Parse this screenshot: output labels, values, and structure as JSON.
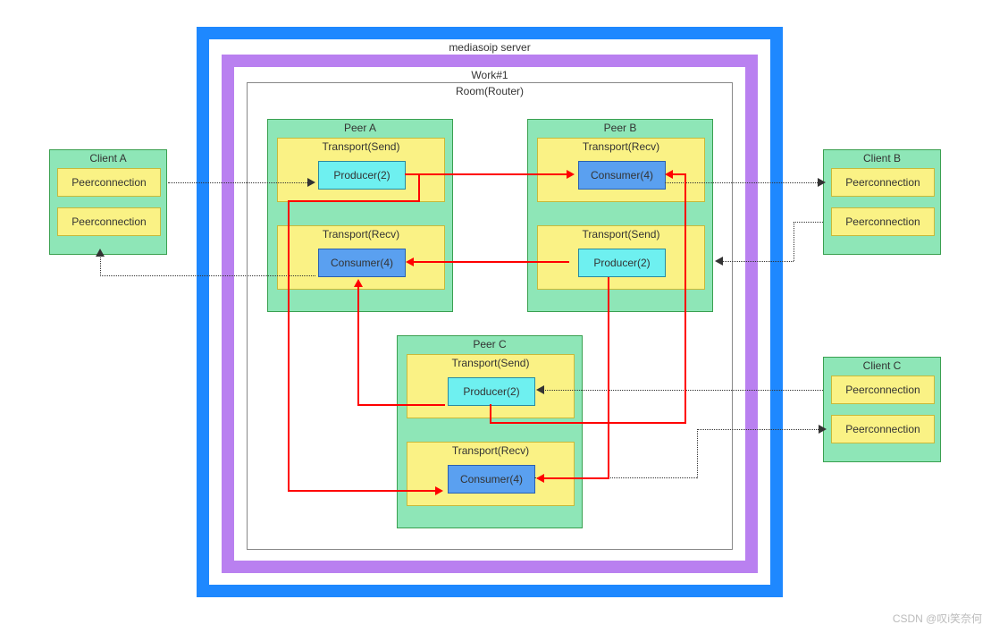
{
  "server": {
    "label": "mediasoip server"
  },
  "work": {
    "label": "Work#1"
  },
  "room": {
    "label": "Room(Router)"
  },
  "clients": {
    "a": {
      "label": "Client A",
      "pc1": "Peerconnection",
      "pc2": "Peerconnection"
    },
    "b": {
      "label": "Client B",
      "pc1": "Peerconnection",
      "pc2": "Peerconnection"
    },
    "c": {
      "label": "Client C",
      "pc1": "Peerconnection",
      "pc2": "Peerconnection"
    }
  },
  "peers": {
    "a": {
      "label": "Peer A",
      "send": {
        "label": "Transport(Send)",
        "node": "Producer(2)"
      },
      "recv": {
        "label": "Transport(Recv)",
        "node": "Consumer(4)"
      }
    },
    "b": {
      "label": "Peer B",
      "recv": {
        "label": "Transport(Recv)",
        "node": "Consumer(4)"
      },
      "send": {
        "label": "Transport(Send)",
        "node": "Producer(2)"
      }
    },
    "c": {
      "label": "Peer C",
      "send": {
        "label": "Transport(Send)",
        "node": "Producer(2)"
      },
      "recv": {
        "label": "Transport(Recv)",
        "node": "Consumer(4)"
      }
    }
  },
  "watermark": "CSDN @叹i笑奈何",
  "chart_data": {
    "type": "diagram",
    "title": "mediasoip server",
    "nodes": [
      {
        "id": "clientA",
        "label": "Client A",
        "children": [
          "clientA.pc1",
          "clientA.pc2"
        ]
      },
      {
        "id": "clientA.pc1",
        "label": "Peerconnection"
      },
      {
        "id": "clientA.pc2",
        "label": "Peerconnection"
      },
      {
        "id": "clientB",
        "label": "Client B",
        "children": [
          "clientB.pc1",
          "clientB.pc2"
        ]
      },
      {
        "id": "clientB.pc1",
        "label": "Peerconnection"
      },
      {
        "id": "clientB.pc2",
        "label": "Peerconnection"
      },
      {
        "id": "clientC",
        "label": "Client C",
        "children": [
          "clientC.pc1",
          "clientC.pc2"
        ]
      },
      {
        "id": "clientC.pc1",
        "label": "Peerconnection"
      },
      {
        "id": "clientC.pc2",
        "label": "Peerconnection"
      },
      {
        "id": "server",
        "label": "mediasoip server",
        "children": [
          "work1"
        ]
      },
      {
        "id": "work1",
        "label": "Work#1",
        "children": [
          "room"
        ]
      },
      {
        "id": "room",
        "label": "Room(Router)",
        "children": [
          "peerA",
          "peerB",
          "peerC"
        ]
      },
      {
        "id": "peerA",
        "label": "Peer A",
        "children": [
          "peerA.send",
          "peerA.recv"
        ]
      },
      {
        "id": "peerA.send",
        "label": "Transport(Send)",
        "children": [
          "peerA.producer"
        ]
      },
      {
        "id": "peerA.producer",
        "label": "Producer(2)"
      },
      {
        "id": "peerA.recv",
        "label": "Transport(Recv)",
        "children": [
          "peerA.consumer"
        ]
      },
      {
        "id": "peerA.consumer",
        "label": "Consumer(4)"
      },
      {
        "id": "peerB",
        "label": "Peer B",
        "children": [
          "peerB.recv",
          "peerB.send"
        ]
      },
      {
        "id": "peerB.recv",
        "label": "Transport(Recv)",
        "children": [
          "peerB.consumer"
        ]
      },
      {
        "id": "peerB.consumer",
        "label": "Consumer(4)"
      },
      {
        "id": "peerB.send",
        "label": "Transport(Send)",
        "children": [
          "peerB.producer"
        ]
      },
      {
        "id": "peerB.producer",
        "label": "Producer(2)"
      },
      {
        "id": "peerC",
        "label": "Peer C",
        "children": [
          "peerC.send",
          "peerC.recv"
        ]
      },
      {
        "id": "peerC.send",
        "label": "Transport(Send)",
        "children": [
          "peerC.producer"
        ]
      },
      {
        "id": "peerC.producer",
        "label": "Producer(2)"
      },
      {
        "id": "peerC.recv",
        "label": "Transport(Recv)",
        "children": [
          "peerC.consumer"
        ]
      },
      {
        "id": "peerC.consumer",
        "label": "Consumer(4)"
      }
    ],
    "edges": [
      {
        "from": "clientA.pc1",
        "to": "peerA.producer",
        "style": "dotted"
      },
      {
        "from": "peerA.consumer",
        "to": "clientA.pc2",
        "style": "dotted"
      },
      {
        "from": "peerB.consumer",
        "to": "clientB.pc1",
        "style": "dotted"
      },
      {
        "from": "clientB.pc2",
        "to": "peerB.producer",
        "style": "dotted"
      },
      {
        "from": "clientC.pc1",
        "to": "peerC.producer",
        "style": "dotted"
      },
      {
        "from": "peerC.consumer",
        "to": "clientC.pc2",
        "style": "dotted"
      },
      {
        "from": "peerA.producer",
        "to": "peerB.consumer",
        "style": "solid-red"
      },
      {
        "from": "peerB.producer",
        "to": "peerA.consumer",
        "style": "solid-red"
      },
      {
        "from": "peerA.producer",
        "to": "peerC.consumer",
        "style": "solid-red"
      },
      {
        "from": "peerB.producer",
        "to": "peerC.consumer",
        "style": "solid-red"
      },
      {
        "from": "peerC.producer",
        "to": "peerA.consumer",
        "style": "solid-red"
      },
      {
        "from": "peerC.producer",
        "to": "peerB.consumer",
        "style": "solid-red"
      }
    ]
  }
}
